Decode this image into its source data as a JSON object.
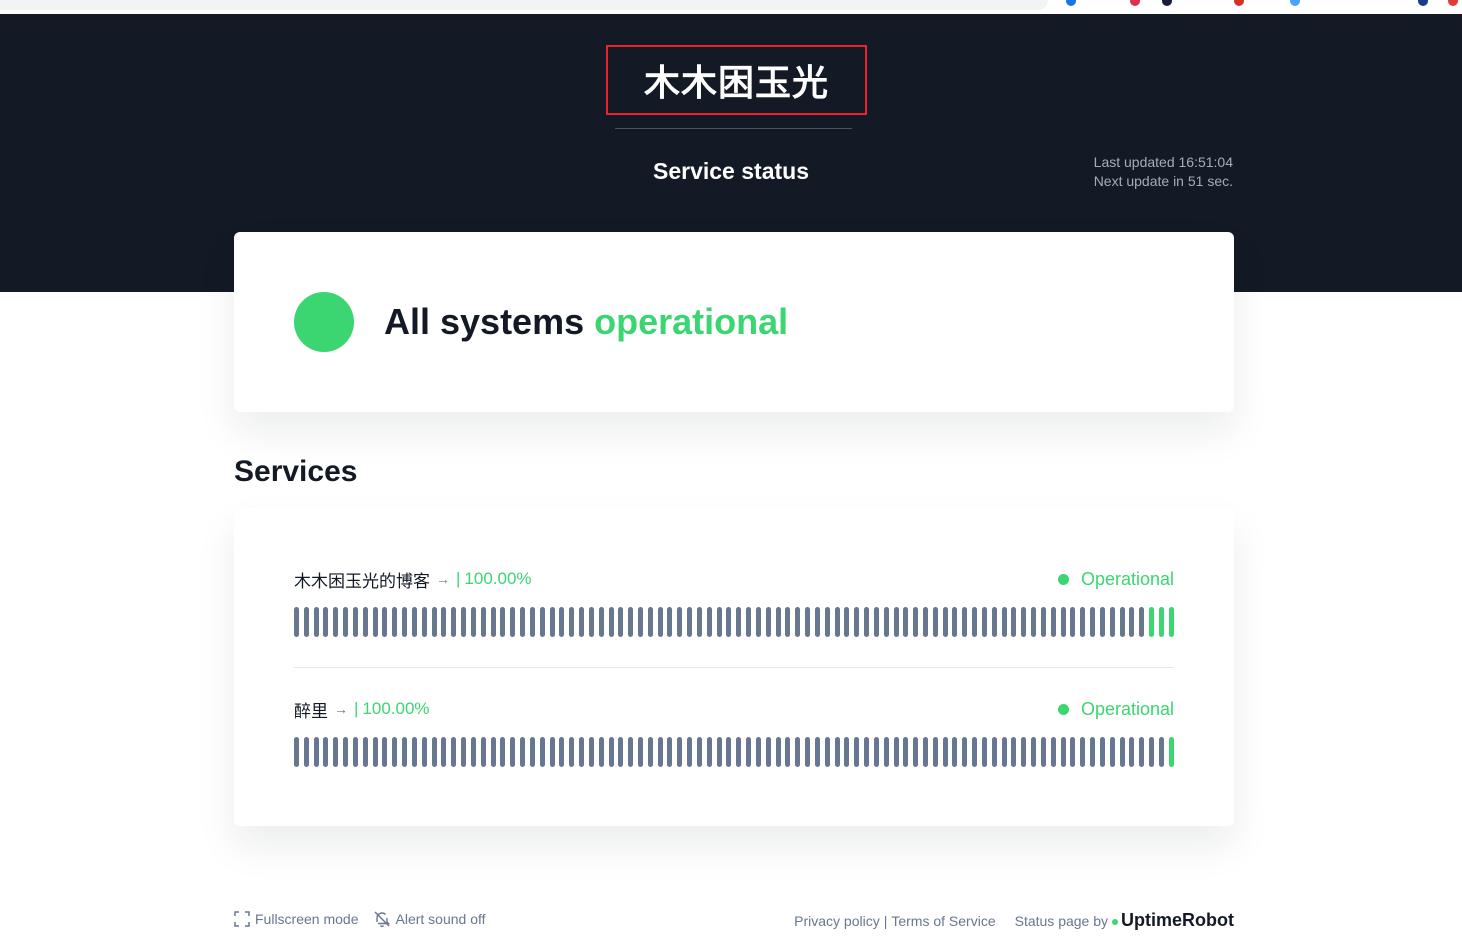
{
  "header": {
    "brand_title": "木木困玉光",
    "page_title": "Service status",
    "last_updated": "Last updated 16:51:04",
    "next_update": "Next update in 51 sec."
  },
  "overall": {
    "text_prefix": "All systems",
    "text_status": "operational",
    "color": "#3bd671"
  },
  "services": {
    "heading": "Services",
    "monitors": [
      {
        "name": "木木困玉光的博客",
        "arrow_icon": "arrow-right-icon",
        "separator": "|",
        "uptime": "100.00%",
        "status": "Operational",
        "bars_total": 90,
        "bars_up_recent": 3
      },
      {
        "name": "醉里",
        "arrow_icon": "arrow-right-icon",
        "separator": "|",
        "uptime": "100.00%",
        "status": "Operational",
        "bars_total": 90,
        "bars_up_recent": 1
      }
    ]
  },
  "footer": {
    "fullscreen_label": "Fullscreen mode",
    "fullscreen_icon": "fullscreen-icon",
    "alert_label": "Alert sound off",
    "alert_icon": "bell-off-icon",
    "privacy_label": "Privacy policy",
    "terms_label": "Terms of Service",
    "pipe": "|",
    "status_page_by": "Status page by",
    "brand": "UptimeRobot"
  },
  "colors": {
    "hero_bg": "#131a26",
    "operational": "#3bd671",
    "bar_neutral": "#687790",
    "highlight_border": "#e8232e"
  }
}
